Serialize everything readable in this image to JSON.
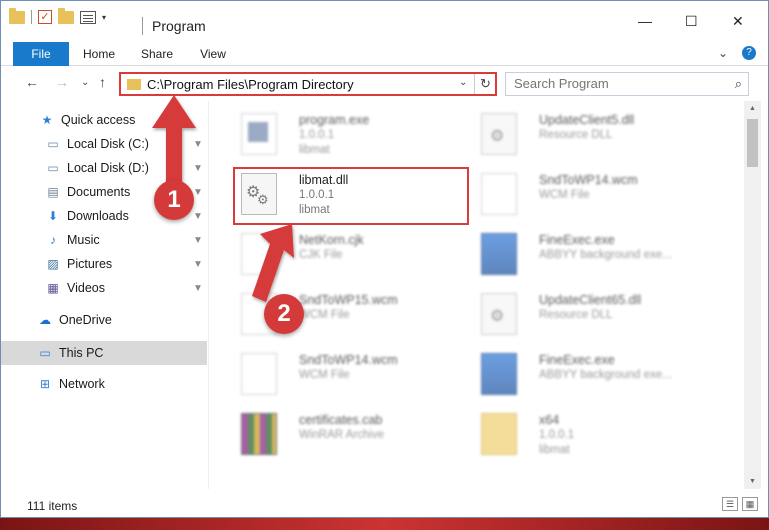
{
  "window": {
    "title": "Program",
    "controls": {
      "minimize": "—",
      "maximize": "☐",
      "close": "✕"
    }
  },
  "ribbon": {
    "tabs": [
      "File",
      "Home",
      "Share",
      "View"
    ],
    "expand": "⌄",
    "help": "?"
  },
  "navigation": {
    "back": "←",
    "forward": "→",
    "recent": "⌄",
    "up": "↑",
    "address": "C:\\Program Files\\Program Directory",
    "address_dropdown": "⌄",
    "refresh": "↻",
    "search_placeholder": "Search Program",
    "search_icon": "⌕"
  },
  "sidebar": {
    "items": [
      {
        "label": "Quick access",
        "icon": "star-icon",
        "glyph": "★",
        "color": "#2f7fd6",
        "pinned": false
      },
      {
        "label": "Local Disk (C:)",
        "icon": "drive-icon",
        "glyph": "▭",
        "color": "#6a8aa8",
        "pinned": true
      },
      {
        "label": "Local Disk (D:)",
        "icon": "drive-icon",
        "glyph": "▭",
        "color": "#6a8aa8",
        "pinned": true
      },
      {
        "label": "Documents",
        "icon": "documents-icon",
        "glyph": "▤",
        "color": "#6a7d8f",
        "pinned": true
      },
      {
        "label": "Downloads",
        "icon": "downloads-icon",
        "glyph": "⬇",
        "color": "#2f7fd6",
        "pinned": true
      },
      {
        "label": "Music",
        "icon": "music-icon",
        "glyph": "♪",
        "color": "#2f7fd6",
        "pinned": true
      },
      {
        "label": "Pictures",
        "icon": "pictures-icon",
        "glyph": "▨",
        "color": "#3b6f9e",
        "pinned": true
      },
      {
        "label": "Videos",
        "icon": "videos-icon",
        "glyph": "▦",
        "color": "#5b4d8f",
        "pinned": true
      },
      {
        "label": "OneDrive",
        "icon": "cloud-icon",
        "glyph": "☁",
        "color": "#1a6fd0",
        "pinned": false
      },
      {
        "label": "This PC",
        "icon": "computer-icon",
        "glyph": "▭",
        "color": "#2f7fd6",
        "pinned": false,
        "selected": true
      },
      {
        "label": "Network",
        "icon": "network-icon",
        "glyph": "⊞",
        "color": "#2f7fd6",
        "pinned": false
      }
    ],
    "pin_glyph": "📌"
  },
  "files": [
    {
      "name": "program.exe",
      "line2": "1.0.0.1",
      "line3": "libmat",
      "icon": "exe-icon",
      "blurred": true
    },
    {
      "name": "UpdateClient5.dll",
      "line2": "Resource DLL",
      "line3": "",
      "icon": "dll-icon",
      "blurred": true
    },
    {
      "name": "libmat.dll",
      "line2": "1.0.0.1",
      "line3": "libmat",
      "icon": "dll-icon",
      "blurred": false
    },
    {
      "name": "SndToWP14.wcm",
      "line2": "WCM File",
      "line3": "",
      "icon": "document-icon",
      "blurred": true
    },
    {
      "name": "NetKorn.cjk",
      "line2": "CJK File",
      "line3": "",
      "icon": "document-icon",
      "blurred": true
    },
    {
      "name": "FineExec.exe",
      "line2": "ABBYY background exe...",
      "line3": "",
      "icon": "app-icon",
      "blurred": true
    },
    {
      "name": "SndToWP15.wcm",
      "line2": "WCM File",
      "line3": "",
      "icon": "document-icon",
      "blurred": true
    },
    {
      "name": "UpdateClient65.dll",
      "line2": "Resource DLL",
      "line3": "",
      "icon": "dll-icon",
      "blurred": true
    },
    {
      "name": "SndToWP14.wcm",
      "line2": "WCM File",
      "line3": "",
      "icon": "document-icon",
      "blurred": true
    },
    {
      "name": "FineExec.exe",
      "line2": "ABBYY background exe...",
      "line3": "",
      "icon": "app-icon",
      "blurred": true
    },
    {
      "name": "certificates.cab",
      "line2": "WinRAR Archive",
      "line3": "",
      "icon": "archive-icon",
      "blurred": true
    },
    {
      "name": "x64",
      "line2": "1.0.0.1",
      "line3": "libmat",
      "icon": "folder-icon",
      "blurred": true
    }
  ],
  "status": {
    "item_count": "111 items",
    "details_view": "☰",
    "large_icons_view": "▦"
  },
  "annotations": {
    "step1": "1",
    "step2": "2"
  },
  "colors": {
    "accent": "#1979ca",
    "highlight": "#d93a3a",
    "selected": "#d9d9d9"
  }
}
